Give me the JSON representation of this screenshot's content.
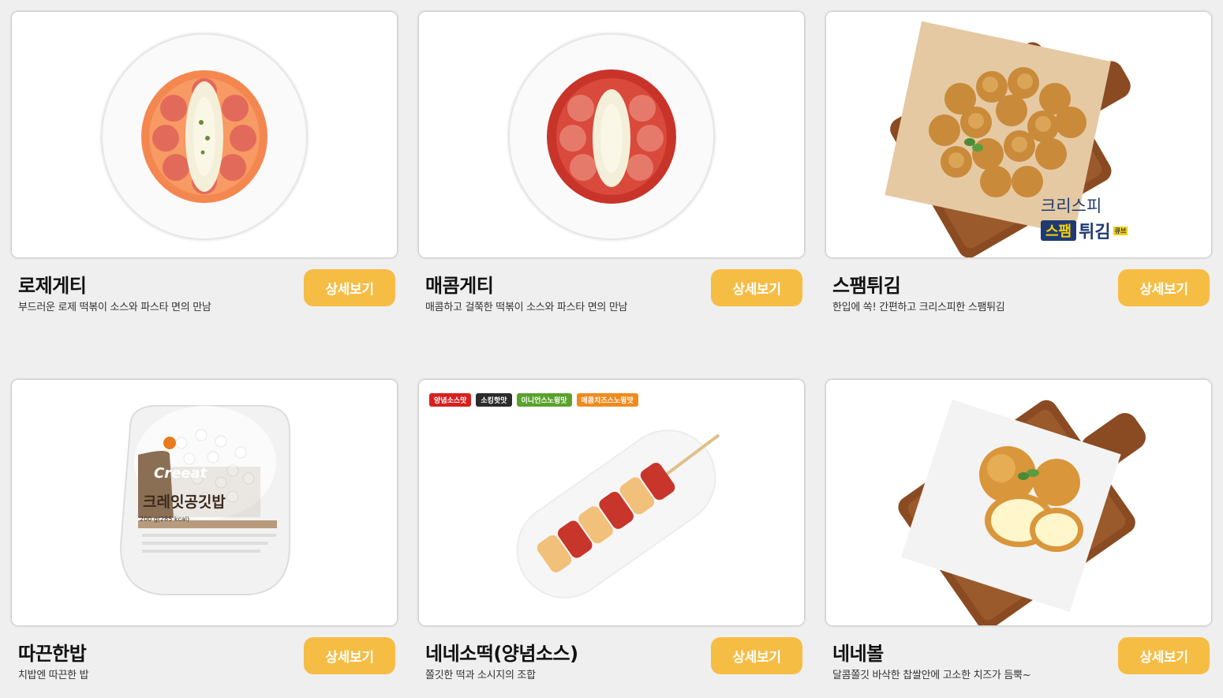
{
  "products": [
    {
      "name": "로제게티",
      "description": "부드러운 로제 떡볶이 소스와 파스타 면의 만남",
      "button": "상세보기",
      "image": "rose-pasta-plate"
    },
    {
      "name": "매콤게티",
      "description": "매콤하고 걸쭉한 떡볶이 소스와 파스타 면의 만남",
      "button": "상세보기",
      "image": "spicy-pasta-plate"
    },
    {
      "name": "스팸튀김",
      "description": "한입에 쏙! 간편하고 크리스피한 스팸튀김",
      "button": "상세보기",
      "image": "spam-fries-board",
      "brand_line1": "크리스피",
      "brand_spam": "스팸",
      "brand_fry": "튀김",
      "brand_cube": "큐브"
    },
    {
      "name": "따끈한밥",
      "description": "치밥엔 따끈한 밥",
      "button": "상세보기",
      "image": "rice-bowl",
      "package_brand": "Creeat",
      "package_name": "크레잇공깃밥",
      "package_weight": "200 g(285 kcal)"
    },
    {
      "name": "네네소떡(양념소스)",
      "description": "쫄깃한 떡과 소시지의 조합",
      "button": "상세보기",
      "image": "sotteok-skewer",
      "tags": [
        "양념소스맛",
        "소킹핫맛",
        "이니언스노윙맛",
        "매콤치즈스노윙맛"
      ]
    },
    {
      "name": "네네볼",
      "description": "달콤쫄깃 바삭한 찹쌀안에 고소한 치즈가 듬뿍~",
      "button": "상세보기",
      "image": "cheese-balls-board"
    }
  ],
  "colors": {
    "button": "#f6bd45",
    "tag_red": "#d72020",
    "tag_dark": "#2b2b2b",
    "tag_green": "#5aa22c",
    "tag_orange": "#f08a1c",
    "spam_navy": "#1f3a73"
  }
}
